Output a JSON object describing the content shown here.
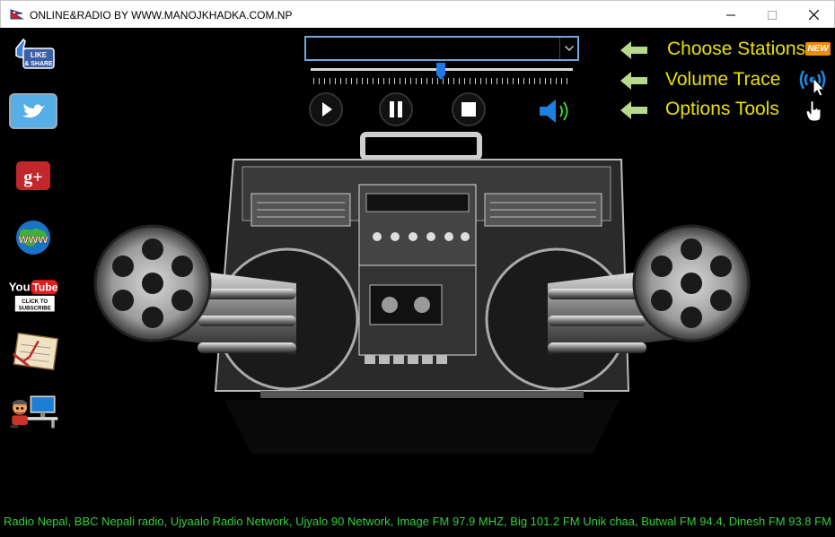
{
  "window": {
    "title": "ONLINE&RADIO BY WWW.MANOJKHADKA.COM.NP"
  },
  "sidebar": {
    "items": [
      {
        "name": "facebook-like-share",
        "line1": "LIKE",
        "line2": "& SHARE"
      },
      {
        "name": "twitter"
      },
      {
        "name": "google-plus",
        "text": "g+"
      },
      {
        "name": "website",
        "text": "www"
      },
      {
        "name": "youtube",
        "line1": "You",
        "line2": "Tube",
        "line3": "CLICK TO",
        "line4": "SUBSCRIBE"
      },
      {
        "name": "guestbook"
      },
      {
        "name": "contact"
      }
    ]
  },
  "player": {
    "station_value": "",
    "volume": 0.5
  },
  "menu": {
    "choose_stations": "Choose Stations",
    "new_badge": "NEW",
    "volume_trace": "Volume Trace",
    "options_tools": "Options Tools"
  },
  "ticker": {
    "text": "Radio Nepal, BBC Nepali radio, Ujyaalo Radio Network, Ujyalo 90 Network, Image FM 97.9 MHZ, Big 101.2 FM Unik chaa, Butwal FM 94.4, Dinesh FM 93.8 FM"
  },
  "colors": {
    "menu_text": "#e8e000",
    "ticker_text": "#33d13a",
    "arrow": "#b7d98c",
    "accent": "#1e7be3"
  }
}
